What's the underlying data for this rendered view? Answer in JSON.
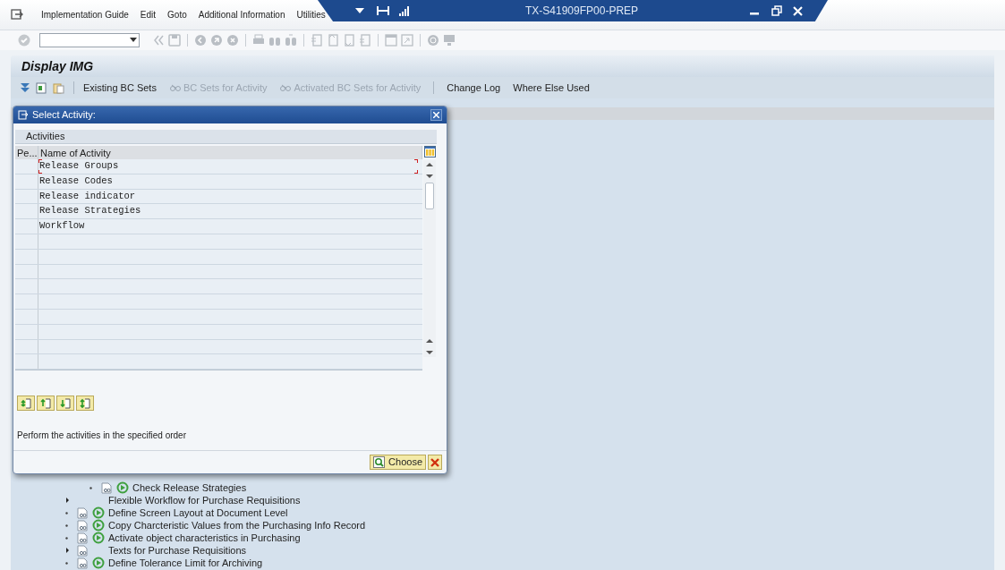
{
  "menu_bar": {
    "items": [
      "Implementation Guide",
      "Edit",
      "Goto",
      "Additional Information",
      "Utilities"
    ]
  },
  "title_banner": {
    "title": "TX-S41909FP00-PREP"
  },
  "screen_title": "Display IMG",
  "app_toolbar": [
    {
      "label": "Existing BC Sets",
      "kind": "plain",
      "disabled": false
    },
    {
      "label": "BC Sets for Activity",
      "kind": "with_icon",
      "disabled": true
    },
    {
      "label": "Activated BC Sets for Activity",
      "kind": "with_icon",
      "disabled": true
    },
    {
      "label": "Change Log",
      "kind": "plain",
      "disabled": false
    },
    {
      "label": "Where Else Used",
      "kind": "plain",
      "disabled": false
    }
  ],
  "tree": {
    "items": [
      {
        "children": [
          {
            "label": "Check Release Strategies",
            "kind": "leaf",
            "doc_icon": true,
            "exec_icon": true
          }
        ]
      },
      {
        "label": "Flexible Workflow for Purchase Requisitions",
        "kind": "folder",
        "doc_icon": false,
        "exec_icon": false
      },
      {
        "label": "Define Screen Layout at Document Level",
        "kind": "leaf",
        "doc_icon": true,
        "exec_icon": true
      },
      {
        "label": "Copy Charcteristic Values from the Purchasing Info Record",
        "kind": "leaf",
        "doc_icon": true,
        "exec_icon": true
      },
      {
        "label": "Activate object characteristics in Purchasing",
        "kind": "leaf",
        "doc_icon": true,
        "exec_icon": true
      },
      {
        "label": "Texts for Purchase Requisitions",
        "kind": "folder",
        "doc_icon": true,
        "exec_icon": false
      },
      {
        "label": "Define Tolerance Limit for Archiving",
        "kind": "leaf",
        "doc_icon": true,
        "exec_icon": true
      }
    ]
  },
  "dialog": {
    "title": "Select Activity:",
    "section_title": "Activities",
    "columns": [
      "Pe...",
      "Name of Activity"
    ],
    "rows": [
      {
        "name": "Release Groups",
        "focused": true
      },
      {
        "name": "Release Codes",
        "focused": false
      },
      {
        "name": "Release indicator",
        "focused": false
      },
      {
        "name": "Release Strategies",
        "focused": false
      },
      {
        "name": "Workflow",
        "focused": false
      }
    ],
    "hint": "Perform the activities in the specified order",
    "buttons": [
      {
        "kind": "choose",
        "label": "Choose"
      },
      {
        "kind": "cancel"
      }
    ]
  }
}
